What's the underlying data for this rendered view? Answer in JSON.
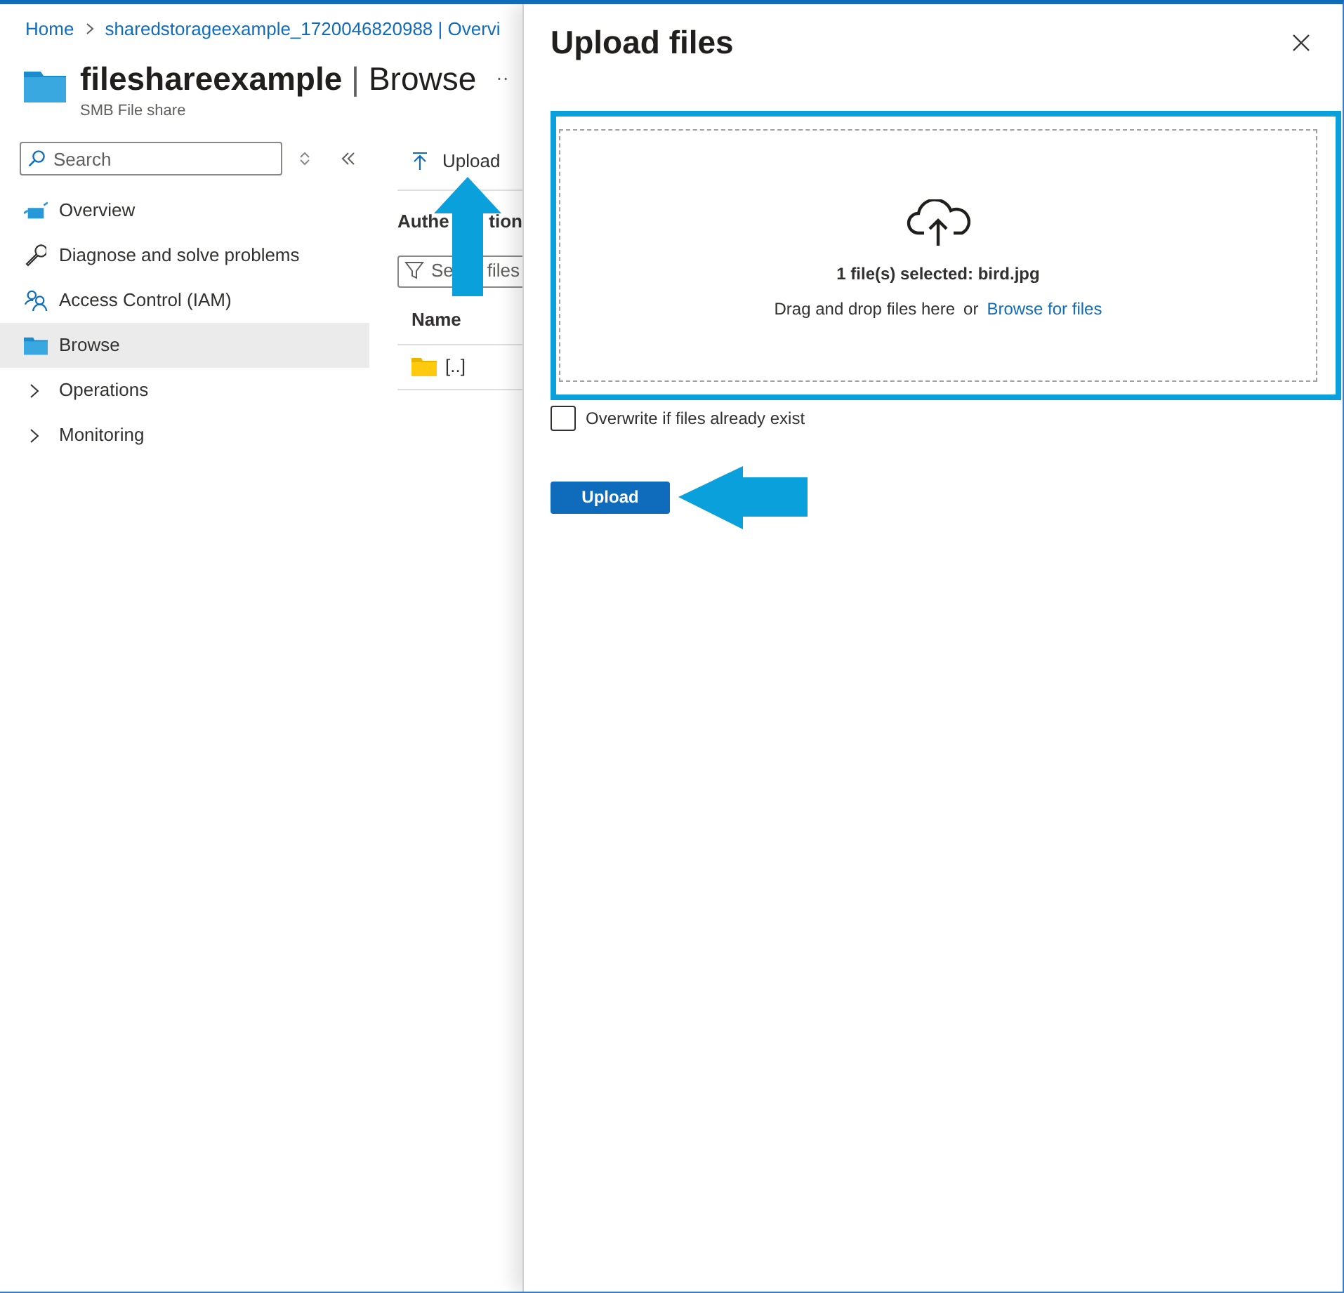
{
  "breadcrumb": [
    {
      "label": "Home"
    },
    {
      "label": "sharedstorageexample_1720046820988 | Overvi"
    }
  ],
  "resource": {
    "name": "fileshareexample",
    "separator": "|",
    "section": "Browse",
    "subtitle": "SMB File share",
    "more": "··"
  },
  "sidebar": {
    "search": {
      "placeholder": "Search"
    },
    "items": [
      {
        "label": "Overview",
        "kind": "link",
        "selected": false
      },
      {
        "label": "Diagnose and solve problems",
        "kind": "link",
        "selected": false
      },
      {
        "label": "Access Control (IAM)",
        "kind": "link",
        "selected": false
      },
      {
        "label": "Browse",
        "kind": "link",
        "selected": true
      },
      {
        "label": "Operations",
        "kind": "group",
        "selected": false
      },
      {
        "label": "Monitoring",
        "kind": "group",
        "selected": false
      }
    ]
  },
  "toolbar": {
    "upload": "Upload"
  },
  "content": {
    "heading_parts": [
      "Authe",
      "tion"
    ],
    "filter_parts": [
      "Se",
      "files"
    ],
    "column": "Name",
    "rows": [
      {
        "name": "[..]"
      }
    ]
  },
  "panel": {
    "title": "Upload files",
    "selected_text": "1 file(s) selected: bird.jpg",
    "hint": "Drag and drop files here",
    "or": "or",
    "browse_link": "Browse for files",
    "overwrite": {
      "label": "Overwrite if files already exist",
      "checked": false
    },
    "button": "Upload"
  }
}
